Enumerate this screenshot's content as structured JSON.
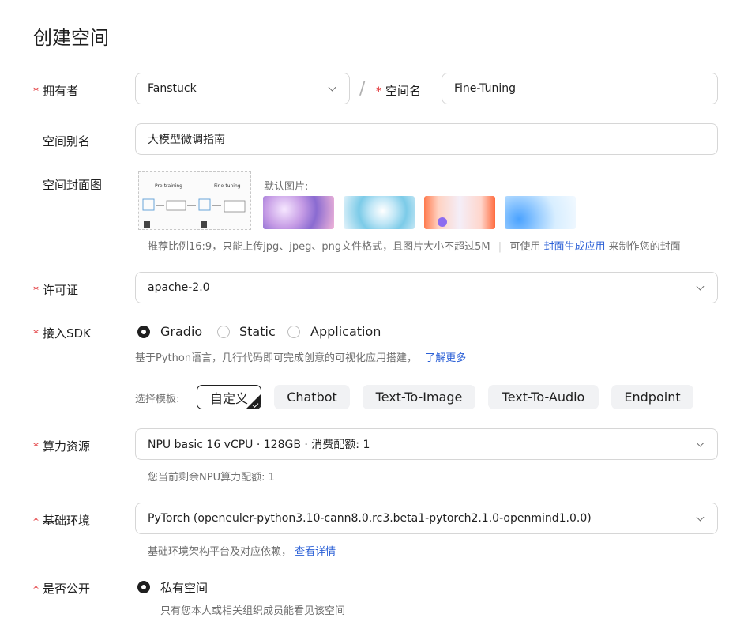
{
  "page": {
    "title": "创建空间"
  },
  "owner": {
    "label": "拥有者",
    "value": "Fanstuck",
    "separator": "/"
  },
  "space_name": {
    "label": "空间名",
    "value": "Fine-Tuning"
  },
  "alias": {
    "label": "空间别名",
    "value": "大模型微调指南"
  },
  "cover": {
    "label": "空间封面图",
    "diagram_left": "Pre-training",
    "diagram_right": "Fine-tuning",
    "default_label": "默认图片:",
    "hint": "推荐比例16:9，只能上传jpg、jpeg、png文件格式，且图片大小不超过5M",
    "hint_prefix": "可使用",
    "hint_link": "封面生成应用",
    "hint_suffix": "来制作您的封面"
  },
  "license": {
    "label": "许可证",
    "value": "apache-2.0"
  },
  "sdk": {
    "label": "接入SDK",
    "options": [
      "Gradio",
      "Static",
      "Application"
    ],
    "selected": "Gradio",
    "description": "基于Python语言，几行代码即可完成创意的可视化应用搭建，",
    "learn_more": "了解更多"
  },
  "templates": {
    "label": "选择模板:",
    "items": [
      "自定义",
      "Chatbot",
      "Text-To-Image",
      "Text-To-Audio",
      "Endpoint"
    ],
    "selected": "自定义"
  },
  "compute": {
    "label": "算力资源",
    "value": "NPU basic 16 vCPU · 128GB · 消费配额: 1",
    "hint": "您当前剩余NPU算力配额: 1"
  },
  "environment": {
    "label": "基础环境",
    "value": "PyTorch (openeuler-python3.10-cann8.0.rc3.beta1-pytorch2.1.0-openmind1.0.0)",
    "hint": "基础环境架构平台及对应依赖，",
    "link": "查看详情"
  },
  "visibility": {
    "label": "是否公开",
    "option": "私有空间",
    "hint": "只有您本人或相关组织成员能看见该空间"
  }
}
